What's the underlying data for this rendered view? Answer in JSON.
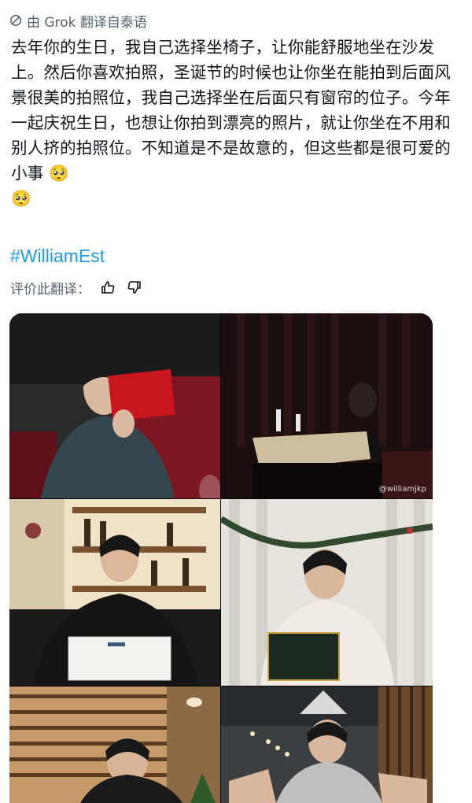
{
  "translation": {
    "label": "由 Grok 翻译自泰语"
  },
  "post": {
    "text": "去年你的生日，我自己选择坐椅子，让你能舒服地坐在沙发上。然后你喜欢拍照，圣诞节的时候也让你坐在能拍到后面风景很美的拍照位，我自己选择坐在后面只有窗帘的位子。今年一起庆祝生日，也想让你拍到漂亮的照片，就让你坐在不用和别人挤的拍照位。不知道是不是故意的，但这些都是很可爱的小事 🥺\n🥺",
    "hashtag": "#WilliamEst"
  },
  "rating": {
    "label": "评价此翻译：",
    "up_icon": "thumbs-up-icon",
    "down_icon": "thumbs-down-icon"
  },
  "photos": {
    "watermark": "@williamjkp",
    "items": [
      {
        "name": "photo-red-booth"
      },
      {
        "name": "photo-dark-curtain"
      },
      {
        "name": "photo-wine-shelf"
      },
      {
        "name": "photo-christmas-garland"
      },
      {
        "name": "photo-window-blinds"
      },
      {
        "name": "photo-restaurant-lamps"
      }
    ]
  },
  "colors": {
    "accent": "#1d9bf0",
    "muted": "#536471",
    "text": "#0f1419"
  }
}
